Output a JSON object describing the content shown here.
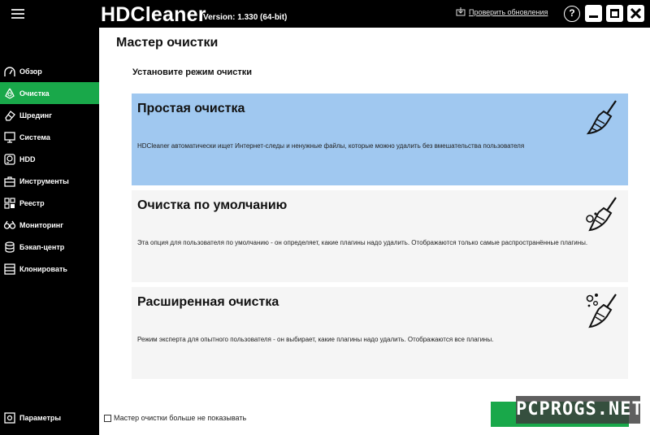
{
  "titlebar": {
    "app_name": "HDCleaner",
    "version": "Version: 1.330 (64-bit)",
    "update_link": "Проверить обновления",
    "help": "?"
  },
  "sidebar": {
    "items": [
      {
        "label": "Обзор",
        "icon": "overview-icon"
      },
      {
        "label": "Очистка",
        "icon": "recycle-icon",
        "active": true
      },
      {
        "label": "Шрединг",
        "icon": "eraser-icon"
      },
      {
        "label": "Система",
        "icon": "system-icon"
      },
      {
        "label": "HDD",
        "icon": "hdd-icon"
      },
      {
        "label": "Инструменты",
        "icon": "toolbox-icon"
      },
      {
        "label": "Реестр",
        "icon": "registry-icon"
      },
      {
        "label": "Мониторинг",
        "icon": "monitoring-icon"
      },
      {
        "label": "Бэкап-центр",
        "icon": "backup-icon"
      },
      {
        "label": "Клонировать",
        "icon": "clone-icon"
      }
    ],
    "settings_label": "Параметры"
  },
  "main": {
    "title": "Мастер очистки",
    "subtitle": "Установите режим очистки",
    "modes": [
      {
        "title": "Простая очистка",
        "description": "HDCleaner автоматически ищет Интернет-следы и ненужные файлы, которые можно удалить без вмешательства пользователя",
        "selected": true
      },
      {
        "title": "Очистка по умолчанию",
        "description": "Эта опция для пользователя по умолчанию - он определяет, какие плагины надо удалить. Отображаются только самые распространённые плагины.",
        "selected": false
      },
      {
        "title": "Расширенная очистка",
        "description": "Режим эксперта для опытного пользователя - он выбирает, какие плагины надо удалить. Отображаются все плагины.",
        "selected": false
      }
    ],
    "dont_show_label": "Мастер очистки больше не показывать",
    "dont_show_checked": false
  },
  "watermark": "PCPROGS.NET",
  "colors": {
    "accent_green": "#19a84a",
    "selected_card": "#a0c8f0",
    "card_bg": "#f5f5f5",
    "background": "#000000"
  }
}
